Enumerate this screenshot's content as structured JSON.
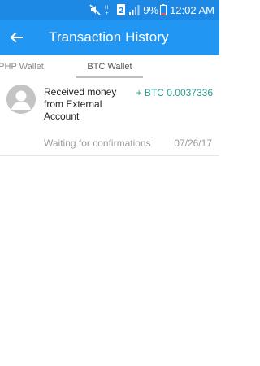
{
  "status_bar": {
    "battery_percent": "9%",
    "time": "12:02 AM",
    "icons": [
      "mute-icon",
      "hd-icon",
      "sim-2-icon",
      "signal-icon",
      "battery-icon"
    ],
    "sim_badge": "2"
  },
  "app_bar": {
    "title": "Transaction History",
    "back_icon": "arrow-left-icon",
    "color": "#2196f3"
  },
  "tabs": [
    {
      "label": "PHP Wallet",
      "selected": false
    },
    {
      "label": "BTC Wallet",
      "selected": true
    }
  ],
  "transactions": [
    {
      "description": "Received money from External Account",
      "amount": "+ BTC 0.0037336",
      "status": "Waiting for confirmations",
      "date": "07/26/17",
      "avatar_icon": "default-avatar-icon",
      "amount_color": "#2a9d8f"
    }
  ]
}
